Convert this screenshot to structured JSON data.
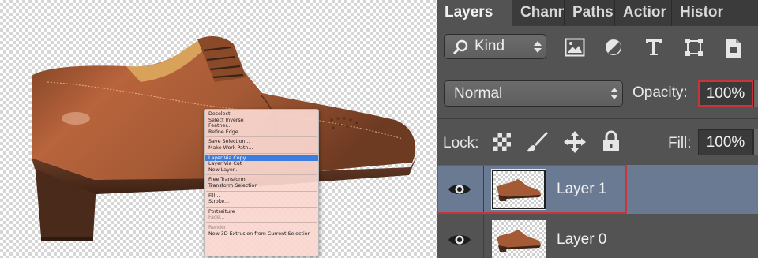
{
  "context_menu": {
    "items": [
      {
        "label": "Deselect"
      },
      {
        "label": "Select Inverse"
      },
      {
        "label": "Feather..."
      },
      {
        "label": "Refine Edge..."
      },
      {
        "label": "Save Selection..."
      },
      {
        "label": "Make Work Path..."
      },
      {
        "label": "Layer Via Copy",
        "highlighted": true
      },
      {
        "label": "Layer Via Cut"
      },
      {
        "label": "New Layer..."
      },
      {
        "label": "Free Transform"
      },
      {
        "label": "Transform Selection"
      },
      {
        "label": "Fill..."
      },
      {
        "label": "Stroke..."
      },
      {
        "label": "Portraiture"
      },
      {
        "label": "Fade...",
        "disabled": true
      },
      {
        "label": "Render",
        "disabled": true
      },
      {
        "label": "New 3D Extrusion from Current Selection"
      }
    ]
  },
  "panel": {
    "tabs": [
      {
        "label": "Layers",
        "active": true
      },
      {
        "label": "Chann"
      },
      {
        "label": "Paths"
      },
      {
        "label": "Actior"
      },
      {
        "label": "Histor"
      }
    ],
    "filter": {
      "kind_label": "Kind",
      "icons": [
        "image-filter-icon",
        "adjustment-filter-icon",
        "type-filter-icon",
        "shape-filter-icon",
        "smart-object-filter-icon"
      ]
    },
    "blend_mode": "Normal",
    "opacity_label": "Opacity:",
    "opacity_value": "100%",
    "lock_label": "Lock:",
    "lock_icons": [
      "lock-transparency-icon",
      "lock-brush-icon",
      "lock-move-icon",
      "lock-all-icon"
    ],
    "fill_label": "Fill:",
    "fill_value": "100%",
    "layers": [
      {
        "name": "Layer 1",
        "selected": true,
        "visible": true
      },
      {
        "name": "Layer 0",
        "selected": false,
        "visible": true
      }
    ]
  },
  "colors": {
    "panel_bg": "#535353",
    "selected_row": "#6a7a92",
    "highlight_outline": "#c7353a",
    "menu_highlight": "#3d7de0"
  }
}
